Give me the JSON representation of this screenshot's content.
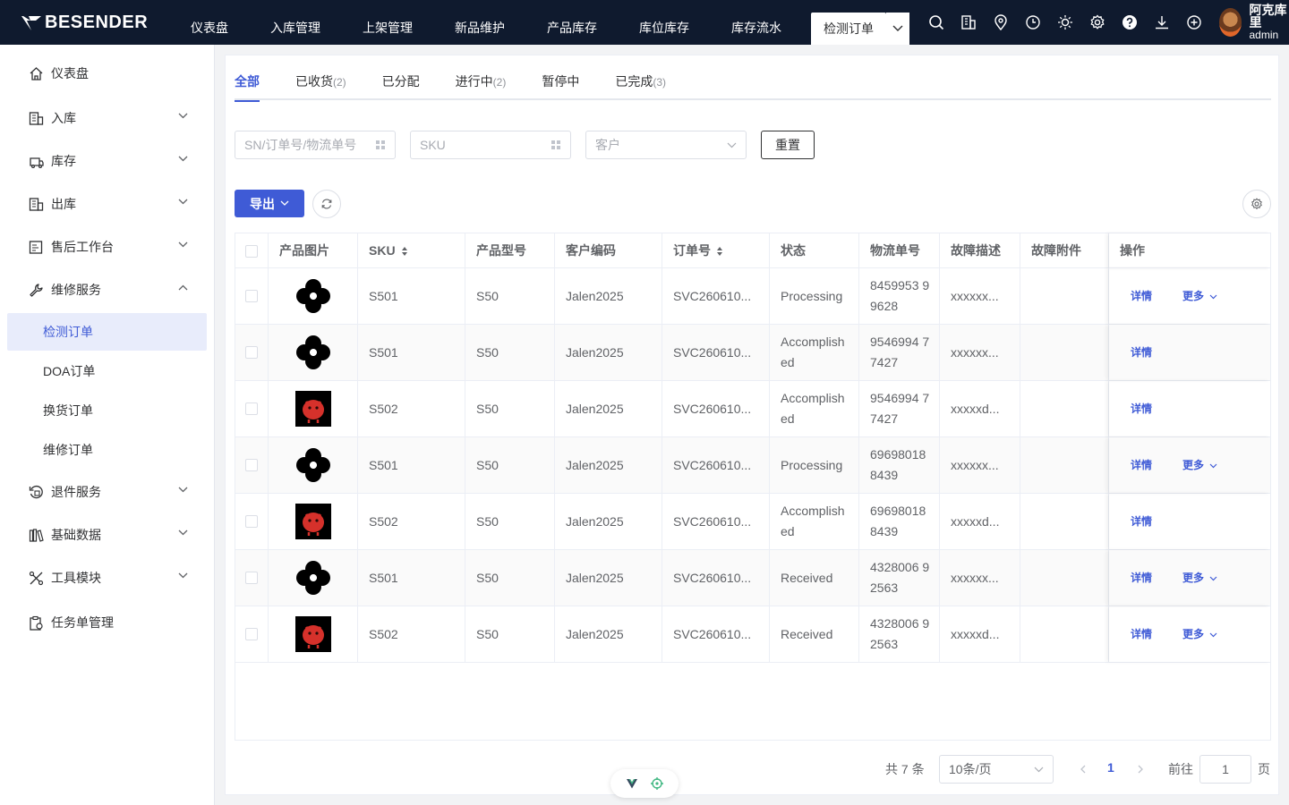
{
  "brand": {
    "name": "BESENDER"
  },
  "topnav": {
    "items": [
      "仪表盘",
      "入库管理",
      "上架管理",
      "新品维护",
      "产品库存",
      "库位库存",
      "库存流水"
    ],
    "active": "检测订单",
    "icons": [
      "search-icon",
      "building-icon",
      "location-icon",
      "clock-icon",
      "sun-icon",
      "settings-icon",
      "help-icon",
      "download-icon",
      "plus-circle-icon"
    ]
  },
  "user": {
    "name": "阿克库里",
    "role": "admin"
  },
  "sidebar": {
    "items": [
      {
        "label": "仪表盘",
        "icon": "home-icon"
      },
      {
        "label": "入库",
        "icon": "inbound-icon"
      },
      {
        "label": "库存",
        "icon": "inventory-icon"
      },
      {
        "label": "出库",
        "icon": "outbound-icon"
      },
      {
        "label": "售后工作台",
        "icon": "aftersales-icon"
      },
      {
        "label": "维修服务",
        "icon": "wrench-icon"
      },
      {
        "label": "退件服务",
        "icon": "return-icon"
      },
      {
        "label": "基础数据",
        "icon": "database-icon"
      },
      {
        "label": "工具模块",
        "icon": "tools-icon"
      },
      {
        "label": "任务单管理",
        "icon": "task-icon"
      }
    ],
    "sub_items": [
      "检测订单",
      "DOA订单",
      "换货订单",
      "维修订单"
    ]
  },
  "tabs": [
    {
      "label": "全部",
      "count": ""
    },
    {
      "label": "已收货",
      "count": "(2)"
    },
    {
      "label": "已分配",
      "count": ""
    },
    {
      "label": "进行中",
      "count": "(2)"
    },
    {
      "label": "暂停中",
      "count": ""
    },
    {
      "label": "已完成",
      "count": "(3)"
    }
  ],
  "filters": {
    "sn_placeholder": "SN/订单号/物流单号",
    "sku_placeholder": "SKU",
    "customer_placeholder": "客户",
    "reset_label": "重置"
  },
  "toolbar": {
    "export_label": "导出"
  },
  "table": {
    "columns": [
      "产品图片",
      "SKU",
      "产品型号",
      "客户编码",
      "订单号",
      "状态",
      "物流单号",
      "故障描述",
      "故障附件",
      "操作"
    ],
    "rows": [
      {
        "image": "clover",
        "sku": "S501",
        "model": "S50",
        "customer": "Jalen2025",
        "order": "SVC260610...",
        "status": "Processing",
        "tracking": "8459953 99628",
        "fault": "xxxxxx...",
        "attachment": "",
        "detail": "详情",
        "more": "更多"
      },
      {
        "image": "clover",
        "sku": "S501",
        "model": "S50",
        "customer": "Jalen2025",
        "order": "SVC260610...",
        "status": "Accomplish ed",
        "tracking": "9546994 77427",
        "fault": "xxxxxx...",
        "attachment": "",
        "detail": "详情",
        "more": ""
      },
      {
        "image": "red-creature",
        "sku": "S502",
        "model": "S50",
        "customer": "Jalen2025",
        "order": "SVC260610...",
        "status": "Accomplish ed",
        "tracking": "9546994 77427",
        "fault": "xxxxxd...",
        "attachment": "",
        "detail": "详情",
        "more": ""
      },
      {
        "image": "clover",
        "sku": "S501",
        "model": "S50",
        "customer": "Jalen2025",
        "order": "SVC260610...",
        "status": "Processing",
        "tracking": "69698018 8439",
        "fault": "xxxxxx...",
        "attachment": "",
        "detail": "详情",
        "more": "更多"
      },
      {
        "image": "red-creature",
        "sku": "S502",
        "model": "S50",
        "customer": "Jalen2025",
        "order": "SVC260610...",
        "status": "Accomplish ed",
        "tracking": "69698018 8439",
        "fault": "xxxxxd...",
        "attachment": "",
        "detail": "详情",
        "more": ""
      },
      {
        "image": "clover",
        "sku": "S501",
        "model": "S50",
        "customer": "Jalen2025",
        "order": "SVC260610...",
        "status": "Received",
        "tracking": "4328006 92563",
        "fault": "xxxxxx...",
        "attachment": "",
        "detail": "详情",
        "more": "更多"
      },
      {
        "image": "red-creature",
        "sku": "S502",
        "model": "S50",
        "customer": "Jalen2025",
        "order": "SVC260610...",
        "status": "Received",
        "tracking": "4328006 92563",
        "fault": "xxxxxd...",
        "attachment": "",
        "detail": "详情",
        "more": "更多"
      }
    ]
  },
  "pagination": {
    "total": "共 7 条",
    "page_size": "10条/页",
    "current_page": "1",
    "goto_label": "前往",
    "goto_value": "1",
    "page_unit": "页"
  },
  "colors": {
    "primary": "#3f5bd6",
    "topbar": "#0f1a2e",
    "active_menu_bg": "#e8ecfb"
  }
}
